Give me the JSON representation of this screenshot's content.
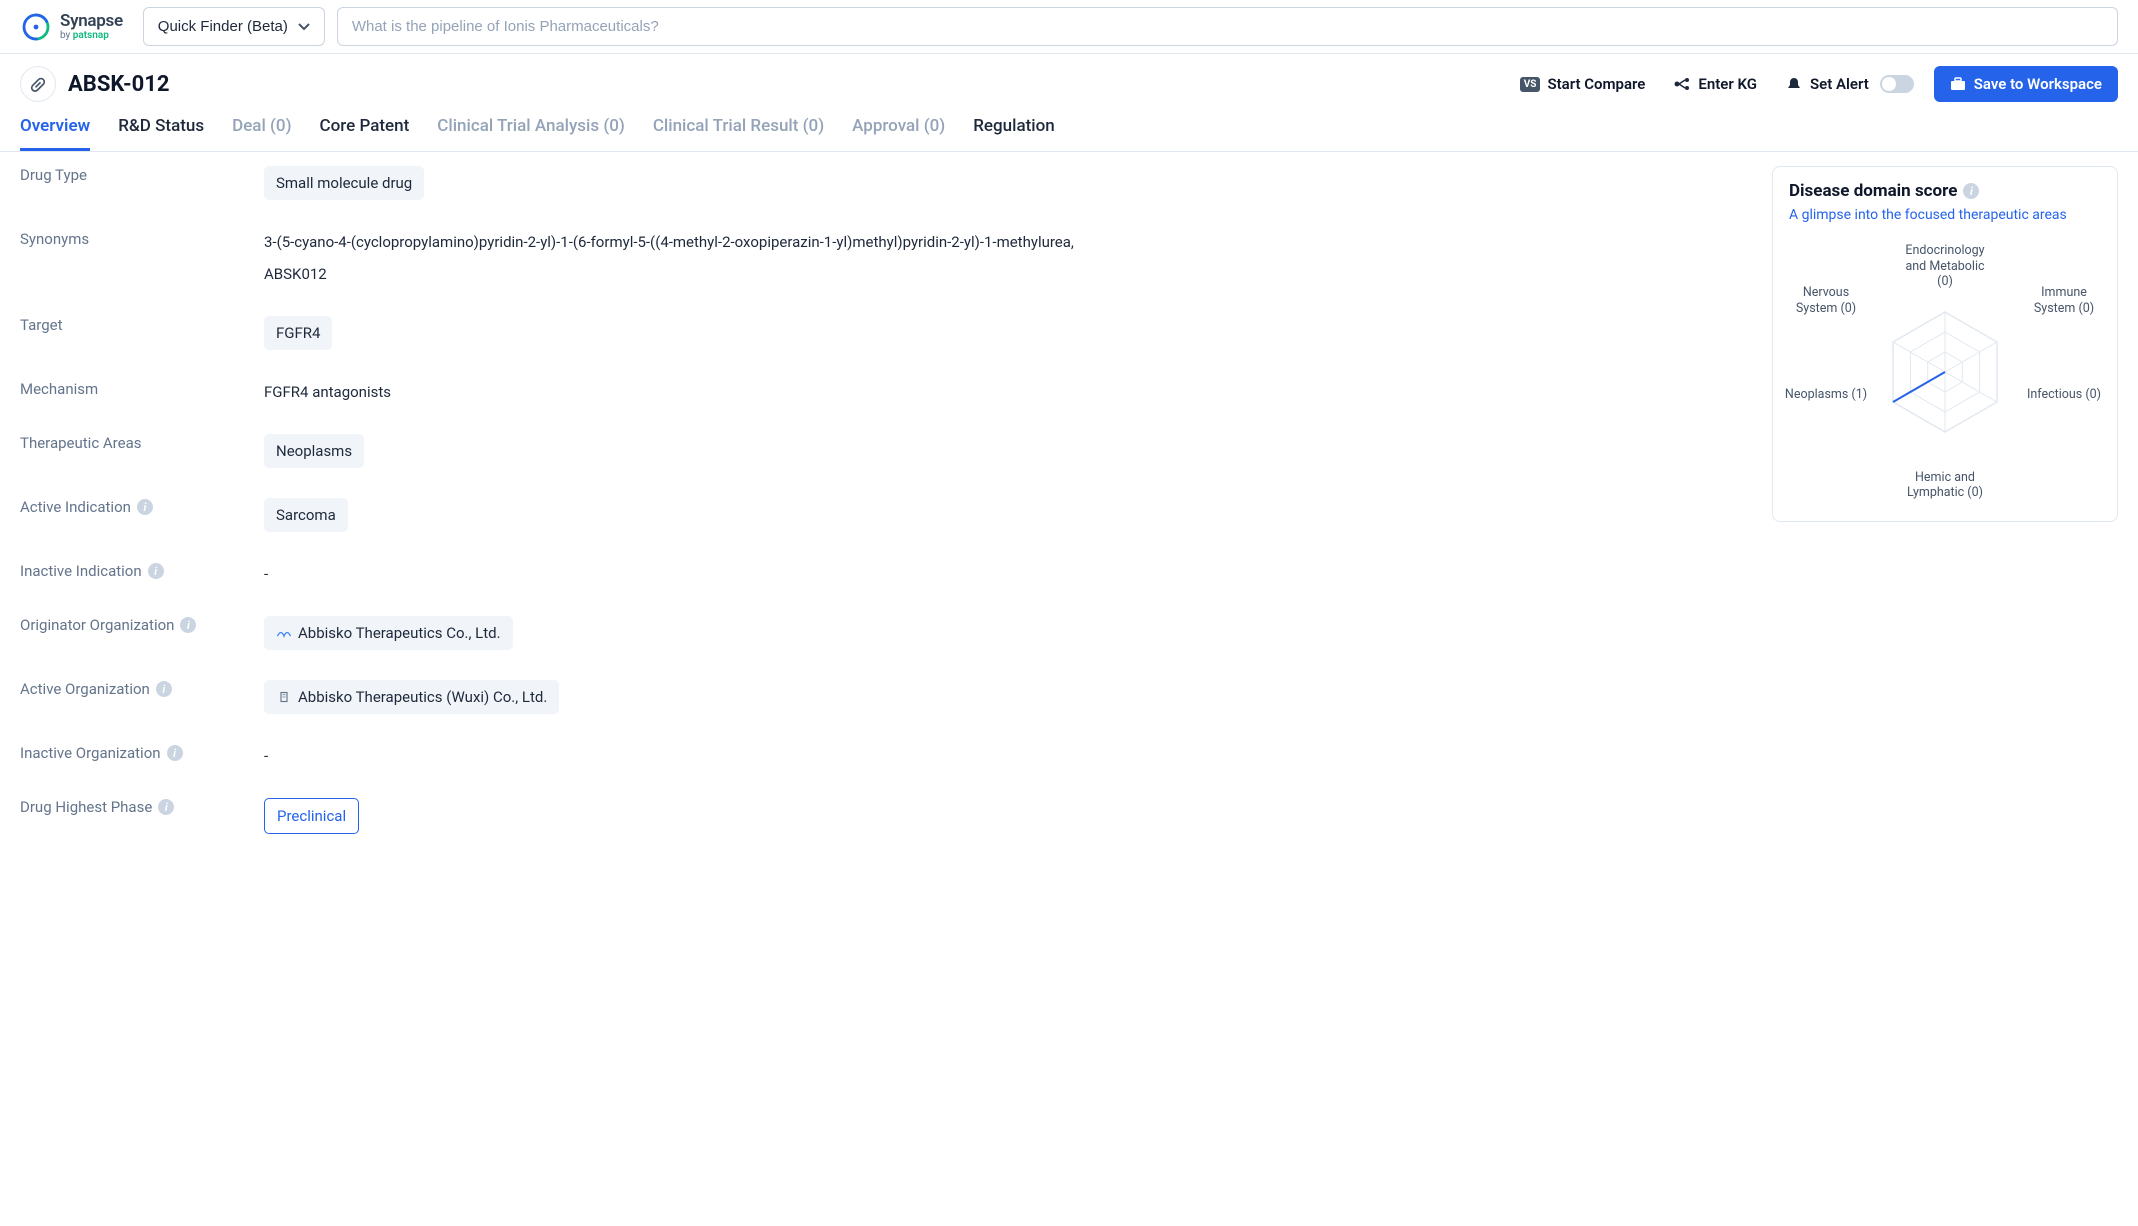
{
  "header": {
    "finder_label": "Quick Finder (Beta)",
    "search_placeholder": "What is the pipeline of Ionis Pharmaceuticals?"
  },
  "titlebar": {
    "drug_name": "ABSK-012",
    "compare": "Start Compare",
    "enter_kg": "Enter KG",
    "set_alert": "Set Alert",
    "save": "Save to Workspace"
  },
  "tabs": [
    {
      "label": "Overview",
      "state": "active"
    },
    {
      "label": "R&D Status",
      "state": "enabled"
    },
    {
      "label": "Deal (0)",
      "state": "disabled"
    },
    {
      "label": "Core Patent",
      "state": "enabled"
    },
    {
      "label": "Clinical Trial Analysis (0)",
      "state": "disabled"
    },
    {
      "label": "Clinical Trial Result (0)",
      "state": "disabled"
    },
    {
      "label": "Approval (0)",
      "state": "disabled"
    },
    {
      "label": "Regulation",
      "state": "enabled"
    }
  ],
  "fields": {
    "drug_type": {
      "label": "Drug Type",
      "value": "Small molecule drug"
    },
    "synonyms": {
      "label": "Synonyms",
      "value1": "3-(5-cyano-4-(cyclopropylamino)pyridin-2-yl)-1-(6-formyl-5-((4-methyl-2-oxopiperazin-1-yl)methyl)pyridin-2-yl)-1-methylurea,",
      "value2": "ABSK012"
    },
    "target": {
      "label": "Target",
      "value": "FGFR4"
    },
    "mechanism": {
      "label": "Mechanism",
      "value": "FGFR4 antagonists"
    },
    "therapeutic": {
      "label": "Therapeutic Areas",
      "value": "Neoplasms"
    },
    "active_ind": {
      "label": "Active Indication",
      "value": "Sarcoma"
    },
    "inactive_ind": {
      "label": "Inactive Indication",
      "value": "-"
    },
    "originator": {
      "label": "Originator Organization",
      "value": "Abbisko Therapeutics Co., Ltd."
    },
    "active_org": {
      "label": "Active Organization",
      "value": "Abbisko Therapeutics (Wuxi) Co., Ltd."
    },
    "inactive_org": {
      "label": "Inactive Organization",
      "value": "-"
    },
    "highest_phase": {
      "label": "Drug Highest Phase",
      "value": "Preclinical"
    }
  },
  "side": {
    "title": "Disease domain score",
    "subtitle": "A glimpse into the focused therapeutic areas"
  },
  "chart_data": {
    "type": "radar",
    "categories": [
      "Endocrinology and Metabolic",
      "Immune System",
      "Infectious",
      "Hemic and Lymphatic",
      "Neoplasms",
      "Nervous System"
    ],
    "values": [
      0,
      0,
      0,
      0,
      1,
      0
    ],
    "max": 3,
    "labels": {
      "endo": "Endocrinology and Metabolic (0)",
      "immune": "Immune System (0)",
      "infectious": "Infectious (0)",
      "hemic": "Hemic and Lymphatic (0)",
      "neoplasms": "Neoplasms (1)",
      "nervous": "Nervous System (0)"
    }
  }
}
